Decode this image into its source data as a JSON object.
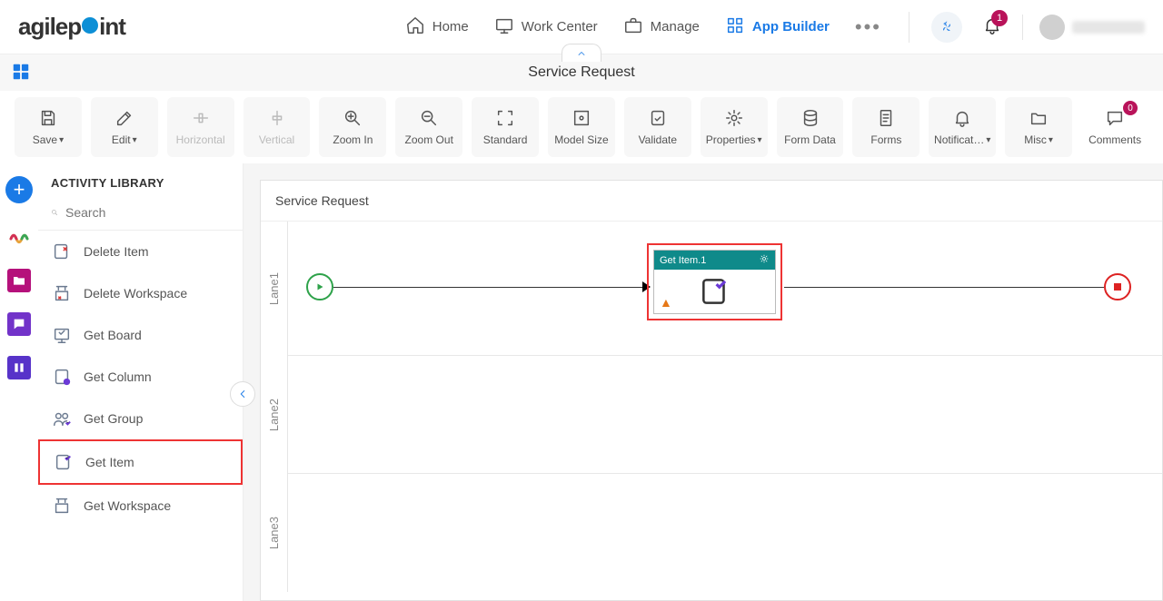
{
  "header": {
    "nav": {
      "home": "Home",
      "work_center": "Work Center",
      "manage": "Manage",
      "app_builder": "App Builder"
    },
    "notification_count": "1"
  },
  "page": {
    "title": "Service Request"
  },
  "toolbar": {
    "save": "Save",
    "edit": "Edit",
    "horizontal": "Horizontal",
    "vertical": "Vertical",
    "zoom_in": "Zoom In",
    "zoom_out": "Zoom Out",
    "standard": "Standard",
    "model_size": "Model Size",
    "validate": "Validate",
    "properties": "Properties",
    "form_data": "Form Data",
    "forms": "Forms",
    "notifications": "Notificat…",
    "misc": "Misc",
    "comments": "Comments",
    "comments_count": "0"
  },
  "library": {
    "title": "ACTIVITY LIBRARY",
    "search_placeholder": "Search",
    "items": [
      {
        "label": "Delete Item"
      },
      {
        "label": "Delete Workspace"
      },
      {
        "label": "Get Board"
      },
      {
        "label": "Get Column"
      },
      {
        "label": "Get Group"
      },
      {
        "label": "Get Item"
      },
      {
        "label": "Get Workspace"
      }
    ]
  },
  "canvas": {
    "title": "Service Request",
    "lanes": [
      "Lane1",
      "Lane2",
      "Lane3"
    ],
    "activity": {
      "title": "Get Item.1"
    }
  }
}
